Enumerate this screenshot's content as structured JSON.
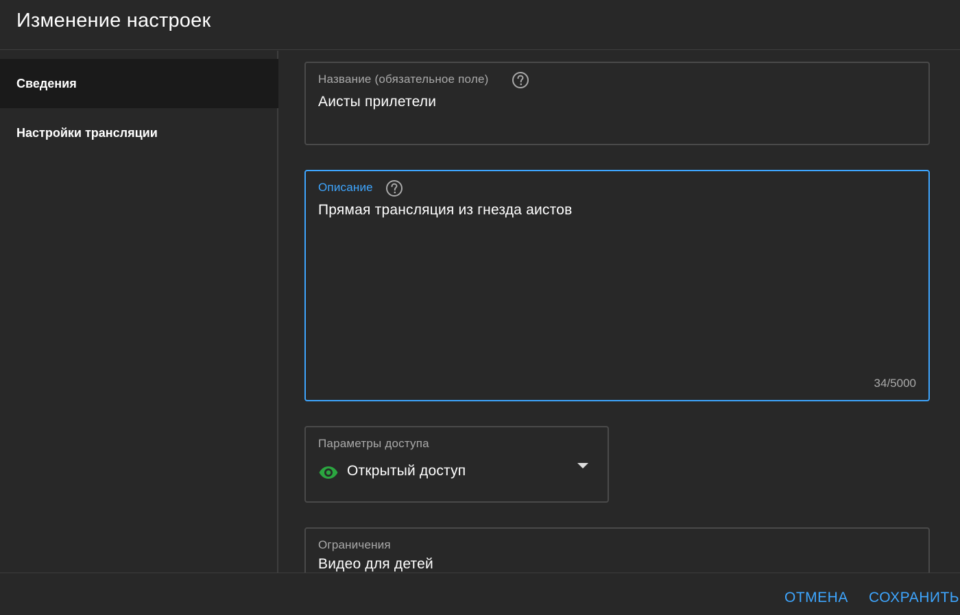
{
  "header": {
    "title": "Изменение настроек"
  },
  "sidebar": {
    "items": [
      {
        "label": "Сведения",
        "active": true
      },
      {
        "label": "Настройки трансляции",
        "active": false
      }
    ]
  },
  "fields": {
    "title": {
      "label": "Название (обязательное поле)",
      "value": "Аисты прилетели",
      "icon": "help-icon"
    },
    "description": {
      "label": "Описание",
      "value": "Прямая трансляция из гнезда аистов",
      "counter": "34/5000",
      "icon": "help-icon"
    },
    "visibility": {
      "label": "Параметры доступа",
      "value": "Открытый доступ",
      "icon": "eye-icon"
    },
    "restrictions": {
      "label": "Ограничения",
      "value": "Видео для детей"
    }
  },
  "footer": {
    "cancel_label": "ОТМЕНА",
    "save_label": "СОХРАНИТЬ"
  },
  "colors": {
    "accent": "#3ea6ff",
    "eye": "#2ba640",
    "background": "#282828"
  }
}
